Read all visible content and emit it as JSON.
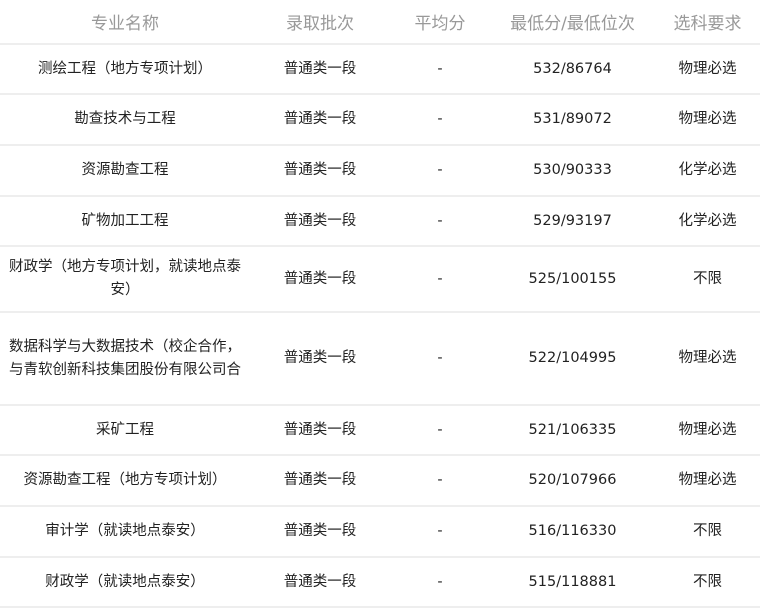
{
  "headers": [
    "专业名称",
    "录取批次",
    "平均分",
    "最低分/最低位次",
    "选科要求"
  ],
  "rows": [
    {
      "name": "测绘工程（地方专项计划）",
      "batch": "普通类一段",
      "avg": "-",
      "min": "532/86764",
      "req": "物理必选"
    },
    {
      "name": "勘查技术与工程",
      "batch": "普通类一段",
      "avg": "-",
      "min": "531/89072",
      "req": "物理必选"
    },
    {
      "name": "资源勘查工程",
      "batch": "普通类一段",
      "avg": "-",
      "min": "530/90333",
      "req": "化学必选"
    },
    {
      "name": "矿物加工工程",
      "batch": "普通类一段",
      "avg": "-",
      "min": "529/93197",
      "req": "化学必选"
    },
    {
      "name": "财政学（地方专项计划，就读地点泰安）",
      "batch": "普通类一段",
      "avg": "-",
      "min": "525/100155",
      "req": "不限"
    },
    {
      "name": "数据科学与大数据技术（校企合作，与青软创新科技集团股份有限公司合",
      "batch": "普通类一段",
      "avg": "-",
      "min": "522/104995",
      "req": "物理必选"
    },
    {
      "name": "采矿工程",
      "batch": "普通类一段",
      "avg": "-",
      "min": "521/106335",
      "req": "物理必选"
    },
    {
      "name": "资源勘查工程（地方专项计划）",
      "batch": "普通类一段",
      "avg": "-",
      "min": "520/107966",
      "req": "物理必选"
    },
    {
      "name": "审计学（就读地点泰安）",
      "batch": "普通类一段",
      "avg": "-",
      "min": "516/116330",
      "req": "不限"
    },
    {
      "name": "财政学（就读地点泰安）",
      "batch": "普通类一段",
      "avg": "-",
      "min": "515/118881",
      "req": "不限"
    }
  ]
}
